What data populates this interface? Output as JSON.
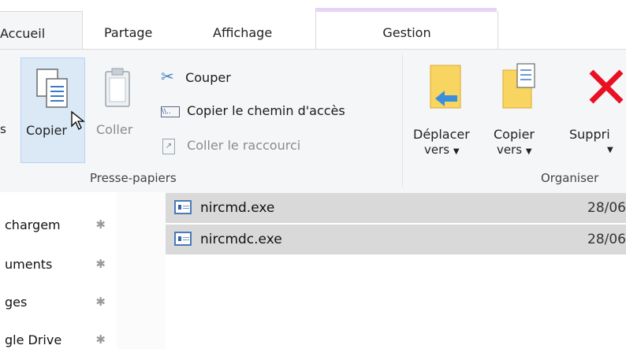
{
  "tabs": {
    "accueil": "Accueil",
    "partage": "Partage",
    "affichage": "Affichage",
    "gestion": "Gestion"
  },
  "ribbon": {
    "presse_papiers": {
      "label": "Presse-papiers",
      "partial_left": "s",
      "copier": "Copier",
      "coller": "Coller",
      "couper": "Couper",
      "copier_chemin": "Copier le chemin d'accès",
      "coller_raccourci": "Coller le raccourci"
    },
    "organiser": {
      "label": "Organiser",
      "deplacer_line1": "Déplacer",
      "deplacer_line2": "vers",
      "copier_line1": "Copier",
      "copier_line2": "vers",
      "supprimer": "Suppri"
    }
  },
  "nav": {
    "items": [
      "chargem",
      "uments",
      "ges",
      "gle Drive"
    ]
  },
  "files": [
    {
      "name": "nircmd.exe",
      "date": "28/06"
    },
    {
      "name": "nircmdc.exe",
      "date": "28/06"
    }
  ],
  "icons": [
    "copy-icon",
    "clipboard-icon",
    "scissors-icon",
    "path-icon",
    "shortcut-icon",
    "move-to-icon",
    "copy-to-icon",
    "delete-icon",
    "pin-icon",
    "exe-file-icon",
    "cursor-icon"
  ],
  "colors": {
    "selected_bg": "#dbe8f6",
    "gestion_accent": "#e7d3f5",
    "delete_red": "#e81123"
  }
}
